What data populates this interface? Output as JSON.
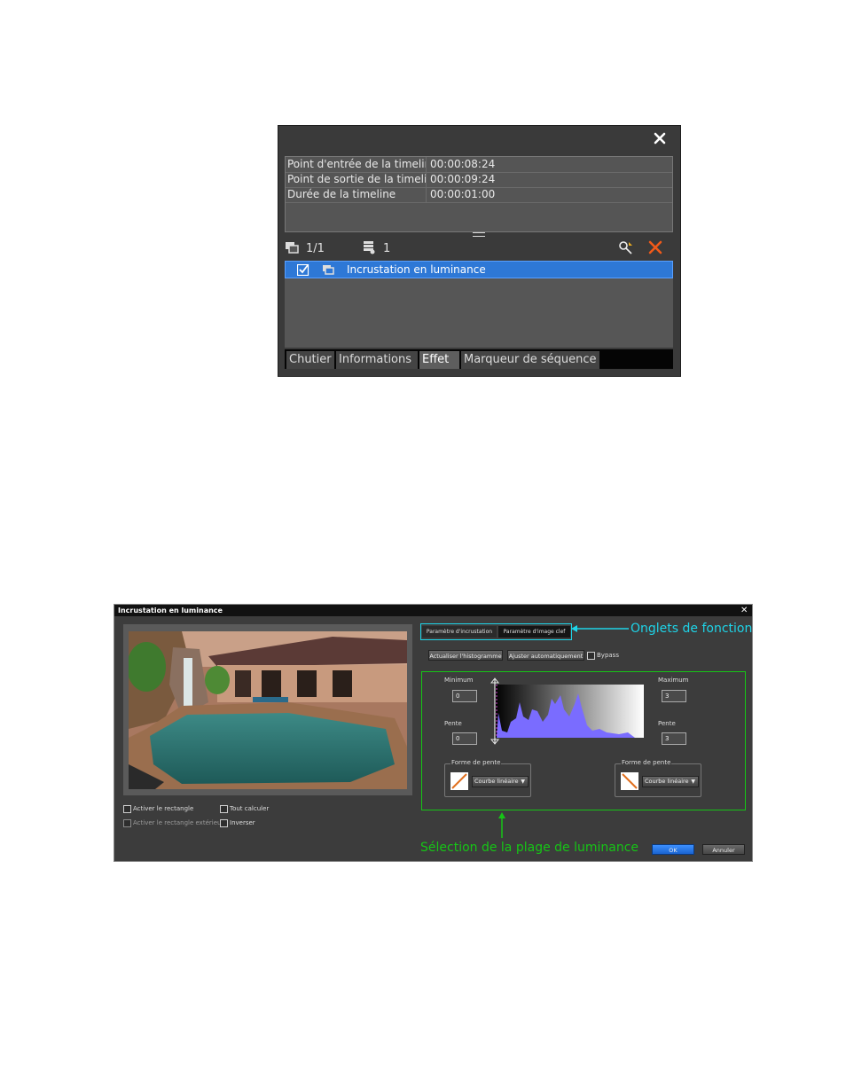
{
  "info_panel": {
    "rows": [
      {
        "label": "Point d'entrée de la timeline",
        "value": "00:00:08:24"
      },
      {
        "label": "Point de sortie de la timeline",
        "value": "00:00:09:24"
      },
      {
        "label": "Durée de la timeline",
        "value": "00:00:01:00"
      }
    ],
    "toolbar": {
      "clip_count": "1/1",
      "layer_count": "1"
    },
    "effects": [
      {
        "label": "Incrustation en luminance",
        "checked": true
      }
    ],
    "tabs": [
      {
        "label": "Chutier",
        "active": false
      },
      {
        "label": "Informations",
        "active": false
      },
      {
        "label": "Effet",
        "active": true
      },
      {
        "label": "Marqueur de séquence",
        "active": false
      }
    ]
  },
  "dialog": {
    "title": "Incrustation en luminance",
    "checkboxes": {
      "enable_rect": "Activer le rectangle",
      "compute_all": "Tout calculer",
      "enable_outer_rect": "Activer le rectangle extérieur",
      "invert": "Inverser"
    },
    "function_tabs": [
      "Paramètre d'incrustation",
      "Paramètre d'image clef"
    ],
    "buttons": {
      "update_histogram": "Actualiser l'histogramme",
      "auto_adjust": "Ajuster automatiquement",
      "bypass": "Bypass",
      "ok": "OK",
      "cancel": "Annuler"
    },
    "minimum": {
      "label": "Minimum",
      "value": "0"
    },
    "maximum": {
      "label": "Maximum",
      "value": "3"
    },
    "slope_left": {
      "label": "Pente",
      "value": "0"
    },
    "slope_right": {
      "label": "Pente",
      "value": "3"
    },
    "slope_shape_left": {
      "label": "Forme de pente",
      "option": "Courbe linéaire"
    },
    "slope_shape_right": {
      "label": "Forme de pente",
      "option": "Courbe linéaire"
    }
  },
  "callouts": {
    "function_tabs": "Onglets de fonction",
    "luminance_range": "Sélection de la plage de luminance"
  },
  "colors": {
    "selection_blue": "#2e78d6",
    "callout_cyan": "#1ed4e8",
    "callout_green": "#16c516",
    "histogram": "#7a6cff"
  }
}
